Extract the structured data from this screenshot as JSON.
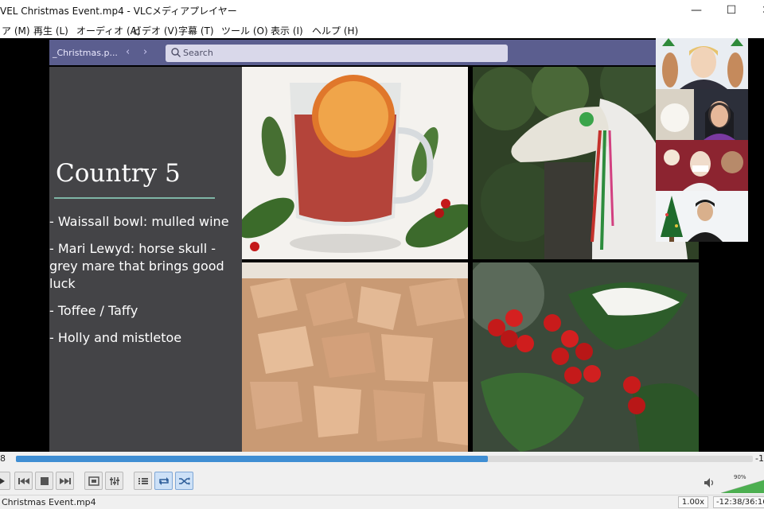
{
  "window": {
    "title": "VEL Christmas Event.mp4 - VLCメディアプレイヤー",
    "minimize_glyph": "—",
    "maximize_glyph": "☐",
    "close_glyph": "✕"
  },
  "menu": {
    "items": [
      {
        "label": "ア (M)"
      },
      {
        "label": "再生 (L)"
      },
      {
        "label": "オーディオ (A)"
      },
      {
        "label": "ビデオ (V)"
      },
      {
        "label": "字幕 (T)"
      },
      {
        "label": "ツール (O)"
      },
      {
        "label": "表示 (I)"
      },
      {
        "label": "ヘルプ (H)"
      }
    ]
  },
  "video_content": {
    "teams": {
      "file_tab": "_Christmas.p...",
      "back_glyph": "‹",
      "forward_glyph": "›",
      "search_placeholder": "Search"
    },
    "slide": {
      "title": "Country 5",
      "bullets": [
        "- Waissall bowl: mulled wine",
        "- Mari Lewyd: horse skull - grey mare that brings good luck",
        "- Toffee / Taffy",
        "- Holly and mistletoe"
      ]
    }
  },
  "playback": {
    "elapsed": "8",
    "remaining": "-1",
    "progress_fraction": 0.64
  },
  "controls": {
    "volume_percent_label": "90%",
    "volume_fraction": 0.9
  },
  "status": {
    "filename": "Christmas Event.mp4",
    "speed": "1.00x",
    "time": "-12:38/36:16"
  },
  "colors": {
    "teams_bar": "#5b5e8f",
    "slide_bg": "#444447",
    "slide_rule": "#7fb6a6",
    "seek_fill": "#3f8ed3",
    "volume_fill": "#4caf50"
  }
}
